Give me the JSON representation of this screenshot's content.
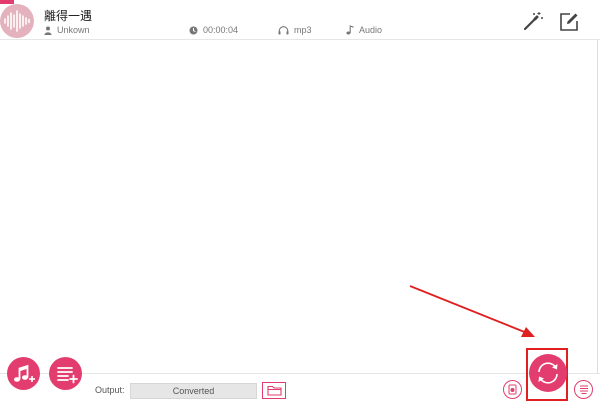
{
  "track": {
    "title": "離得一遇",
    "artist": "Unkown",
    "duration": "00:00:04",
    "format": "mp3",
    "type": "Audio"
  },
  "footer": {
    "output_label": "Output:",
    "output_value": "Converted"
  },
  "colors": {
    "accent": "#e23d6e",
    "thumb": "#e4b2bd",
    "annotation": "#e02020"
  },
  "icons": {
    "thumbnail": "audio-waveform-icon",
    "artist": "person-icon",
    "duration": "clock-icon",
    "format": "headphones-icon",
    "type": "music-note-icon",
    "effects": "magic-wand-icon",
    "edit": "edit-icon",
    "add_music": "add-music-icon",
    "add_playlist": "add-playlist-icon",
    "folder": "folder-icon",
    "history": "history-icon",
    "convert": "convert-icon",
    "queue": "queue-icon"
  }
}
